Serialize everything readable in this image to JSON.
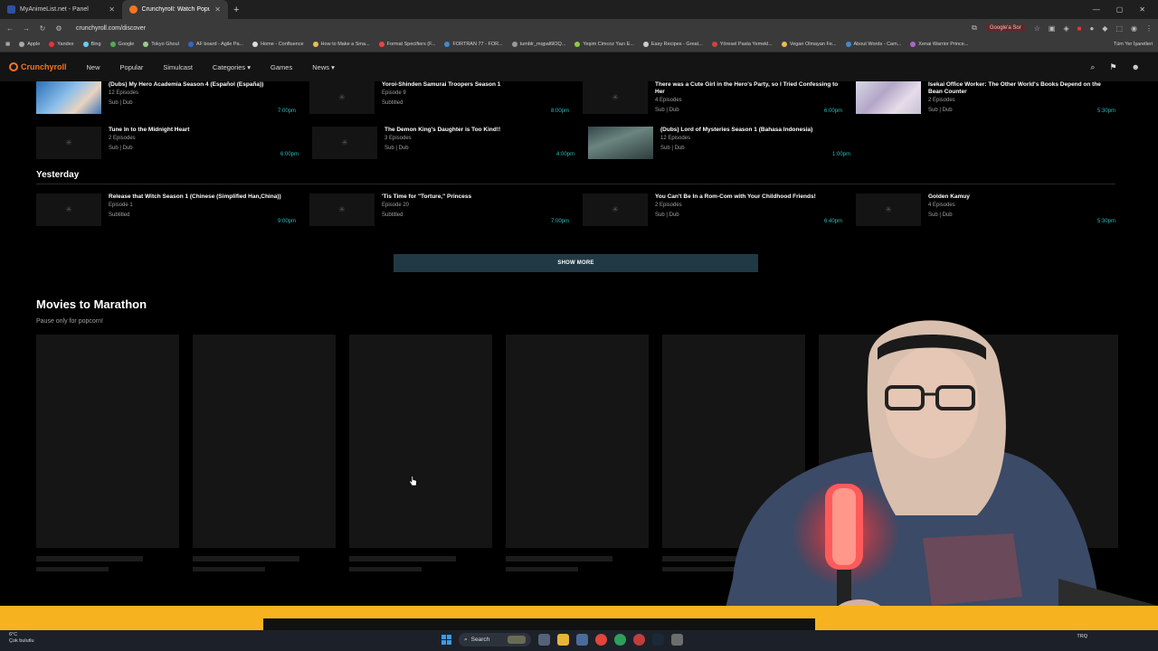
{
  "browser": {
    "tabs": [
      {
        "title": "MyAnimeList.net - Panel",
        "active": false
      },
      {
        "title": "Crunchyroll: Watch Popular Ani",
        "active": true
      }
    ],
    "url": "crunchyroll.com/discover",
    "google_search_chip": "Google'a Sor",
    "bookmarks": [
      "Apple",
      "Yandex",
      "Bing",
      "Google",
      "Tokyo Ghoul",
      "AF board - Agile Pa...",
      "Home - Confluence",
      "How to Make a Sma...",
      "Format Specifiers (F...",
      "FORTRAN 77 - FOR...",
      "tumblr_mqpal6lOQ...",
      "Yeşim Cimcoz Yazı E...",
      "Easy Recipes - Great...",
      "Yöresel Pasta Yemekl...",
      "Vegan Olmayan Fe...",
      "About Words - Cam...",
      "Xenai Warrior Prince..."
    ],
    "bookmarks_right": "Tüm Yer İşaretleri"
  },
  "crunchyroll": {
    "brand": "Crunchyroll",
    "nav": [
      "New",
      "Popular",
      "Simulcast",
      "Categories",
      "Games",
      "News"
    ]
  },
  "today_rows": [
    [
      {
        "title": "(Dubs) My Hero Academia Season 4 (Español (España))",
        "meta": "12 Episodes",
        "langs": "Sub | Dub",
        "time": "7:00pm",
        "thumb": "mha"
      },
      {
        "title": "Yoroi-Shinden Samurai Troopers Season 1",
        "meta": "Episode 9",
        "langs": "Subtitled",
        "time": "8:00pm",
        "thumb": "placeholder"
      },
      {
        "title": "There was a Cute Girl in the Hero's Party, so I Tried Confessing to Her",
        "meta": "4 Episodes",
        "langs": "Sub | Dub",
        "time": "6:00pm",
        "thumb": "placeholder"
      },
      {
        "title": "Isekai Office Worker: The Other World's Books Depend on the Bean Counter",
        "meta": "2 Episodes",
        "langs": "Sub | Dub",
        "time": "5:30pm",
        "thumb": "isek"
      }
    ],
    [
      {
        "title": "Tune In to the Midnight Heart",
        "meta": "2 Episodes",
        "langs": "Sub | Dub",
        "time": "6:00pm",
        "thumb": "placeholder"
      },
      {
        "title": "The Demon King's Daughter is Too Kind!!",
        "meta": "3 Episodes",
        "langs": "Sub | Dub",
        "time": "4:00pm",
        "thumb": "placeholder"
      },
      {
        "title": "(Dubs) Lord of Mysteries Season 1 (Bahasa Indonesia)",
        "meta": "12 Episodes",
        "langs": "Sub | Dub",
        "time": "1:00pm",
        "thumb": "lom"
      }
    ]
  ],
  "yesterday": {
    "heading": "Yesterday",
    "items": [
      {
        "title": "Release that Witch Season 1 (Chinese (Simplified Han,China))",
        "meta": "Episode 1",
        "langs": "Subtitled",
        "time": "9:00pm"
      },
      {
        "title": "'Tis Time for \"Torture,\" Princess",
        "meta": "Episode 20",
        "langs": "Subtitled",
        "time": "7:00pm"
      },
      {
        "title": "You Can't Be In a Rom-Com with Your Childhood Friends!",
        "meta": "2 Episodes",
        "langs": "Sub | Dub",
        "time": "6:40pm"
      },
      {
        "title": "Golden Kamuy",
        "meta": "4 Episodes",
        "langs": "Sub | Dub",
        "time": "5:30pm"
      }
    ]
  },
  "show_more_label": "SHOW MORE",
  "movies": {
    "title": "Movies to Marathon",
    "subtitle": "Pause only for popcorn!",
    "placeholder_count": 7
  },
  "taskbar": {
    "weather_temp": "6°C",
    "weather_desc": "Çok bulutlu",
    "search_label": "Search",
    "tray_lang": "TRQ"
  },
  "colors": {
    "accent": "#f47521",
    "time_teal": "#2abdbb",
    "banner": "#f6b31f",
    "showmore_bg": "#213944"
  }
}
